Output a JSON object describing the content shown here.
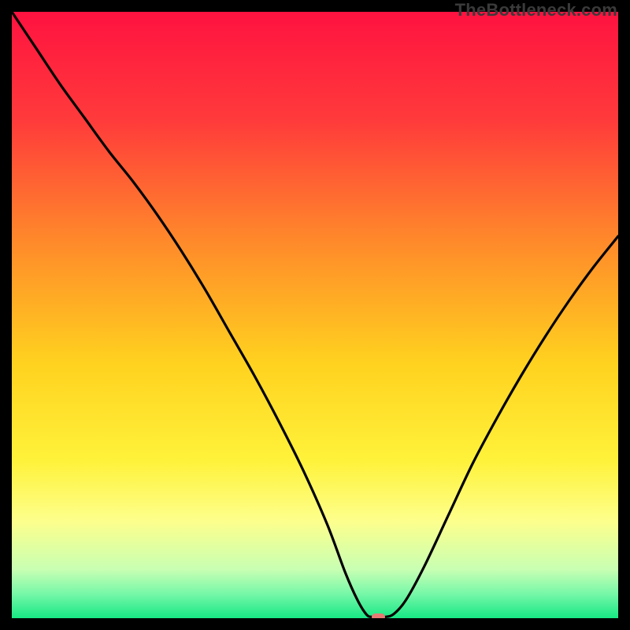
{
  "source_label": "TheBottleneck.com",
  "chart_data": {
    "type": "line",
    "title": "",
    "xlabel": "",
    "ylabel": "",
    "xlim": [
      0,
      100
    ],
    "ylim": [
      0,
      100
    ],
    "gradient_stops": [
      {
        "pos": 0,
        "color": "#ff1240"
      },
      {
        "pos": 18,
        "color": "#ff3b3b"
      },
      {
        "pos": 38,
        "color": "#ff8a2a"
      },
      {
        "pos": 58,
        "color": "#ffd21f"
      },
      {
        "pos": 74,
        "color": "#fff23a"
      },
      {
        "pos": 84,
        "color": "#fdff8c"
      },
      {
        "pos": 92,
        "color": "#c8ffb3"
      },
      {
        "pos": 96,
        "color": "#76f7a8"
      },
      {
        "pos": 100,
        "color": "#17e884"
      }
    ],
    "series": [
      {
        "name": "bottleneck-curve",
        "x": [
          0,
          4,
          8,
          12,
          16,
          20,
          24,
          28,
          32,
          36,
          40,
          44,
          48,
          52,
          55,
          57,
          58.5,
          59.5,
          61.5,
          63,
          65,
          68,
          72,
          76,
          80,
          84,
          88,
          92,
          96,
          100
        ],
        "y": [
          100,
          94,
          88,
          82.5,
          77,
          72,
          66.5,
          60.5,
          54,
          47,
          40,
          32.5,
          24.5,
          15.5,
          7.5,
          3,
          0.6,
          0.2,
          0.2,
          0.7,
          3,
          8.5,
          17,
          25.5,
          33,
          40,
          46.5,
          52.5,
          58,
          63
        ]
      }
    ],
    "min_marker": {
      "x": 60.5,
      "y": 0.2,
      "w": 2.2,
      "h": 1.1
    }
  }
}
